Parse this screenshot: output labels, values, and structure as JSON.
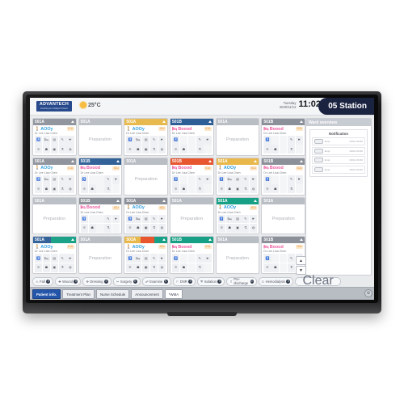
{
  "header": {
    "logo_name": "ADVANTECH",
    "logo_tagline": "Enabling an Intelligent Planet",
    "weather_icon": "sun-icon",
    "temperature": "25°C",
    "day": "Tuesday",
    "date": "2020/11/12",
    "time": "11:02",
    "station": "05 Station"
  },
  "cards": [
    {
      "room": "501A",
      "state": "occupied",
      "header_color": "#8c9099",
      "segments": [],
      "patient": "AOOy",
      "patient_color": "#2f9fe0",
      "patient_icon": "walking-icon",
      "badge": "ICU",
      "doctor": "Dr Lee  Lisa Chen",
      "icons": [
        "wheelchair",
        "bed",
        "clipboard",
        "pen",
        "hand",
        "monitor",
        "person",
        "drip",
        "flask",
        "gauge"
      ],
      "icons_on": [
        1,
        1,
        1,
        1,
        1,
        1,
        1,
        1,
        1,
        1
      ]
    },
    {
      "room": "501A",
      "state": "preparation",
      "header_color": "#b9bdc4",
      "segments": [],
      "prep": "Preparation"
    },
    {
      "room": "501A",
      "state": "occupied",
      "header_color": "#e8b84b",
      "segments": [],
      "patient": "AOOy",
      "patient_color": "#2f9fe0",
      "patient_icon": "walking-icon",
      "badge": "ICU",
      "doctor": "Dr Lee  Lisa Chen",
      "icons": [
        "wheelchair",
        "bed",
        "clipboard",
        "pen",
        "hand",
        "monitor",
        "person",
        "drip",
        "flask",
        "gauge"
      ],
      "icons_on": [
        1,
        1,
        1,
        1,
        1,
        1,
        1,
        1,
        1,
        1
      ]
    },
    {
      "room": "501B",
      "state": "occupied",
      "header_color": "#2e5e96",
      "segments": [],
      "patient": "Boood",
      "patient_color": "#ef5aa0",
      "patient_icon": "bed-icon",
      "badge": "ICU",
      "doctor": "Dr Lee  Lisa Chen",
      "icons": [
        "wheelchair",
        "bed",
        "clipboard",
        "pen",
        "hand",
        "monitor",
        "person",
        "drip",
        "flask",
        "gauge"
      ],
      "icons_on": [
        1,
        0,
        0,
        1,
        1,
        1,
        1,
        0,
        1,
        0
      ]
    },
    {
      "room": "501A",
      "state": "preparation",
      "header_color": "#b9bdc4",
      "segments": [],
      "prep": "Preparation"
    },
    {
      "room": "501B",
      "state": "occupied",
      "header_color": "#8c9099",
      "segments": [],
      "patient": "Boood",
      "patient_color": "#ef5aa0",
      "patient_icon": "bed-icon",
      "badge": "ICU",
      "doctor": "Dr Lee  Lisa Chen",
      "icons": [
        "wheelchair",
        "bed",
        "clipboard",
        "pen",
        "hand",
        "monitor",
        "person",
        "drip",
        "flask",
        "gauge"
      ],
      "icons_on": [
        1,
        0,
        0,
        1,
        1,
        1,
        1,
        0,
        1,
        0
      ]
    },
    {
      "room": "501A",
      "state": "occupied",
      "header_color": "#8c9099",
      "segments": [],
      "patient": "AOOy",
      "patient_color": "#2f9fe0",
      "patient_icon": "walking-icon",
      "badge": "ICU",
      "doctor": "Dr Lee  Lisa Chen",
      "icons": [
        "wheelchair",
        "bed",
        "clipboard",
        "pen",
        "hand",
        "monitor",
        "person",
        "drip",
        "flask",
        "gauge"
      ],
      "icons_on": [
        1,
        1,
        1,
        1,
        1,
        1,
        1,
        1,
        1,
        1
      ]
    },
    {
      "room": "501B",
      "state": "occupied",
      "header_color": "#2e5e96",
      "segments": [],
      "patient": "Boood",
      "patient_color": "#ef5aa0",
      "patient_icon": "bed-icon",
      "badge": "ICU",
      "doctor": "Dr Lee  Lisa Chen",
      "icons": [
        "wheelchair",
        "bed",
        "clipboard",
        "pen",
        "hand",
        "monitor",
        "person",
        "drip",
        "flask",
        "gauge"
      ],
      "icons_on": [
        1,
        0,
        0,
        1,
        1,
        1,
        1,
        0,
        1,
        0
      ]
    },
    {
      "room": "501A",
      "state": "preparation",
      "header_color": "#b9bdc4",
      "segments": [],
      "prep": "Preparation"
    },
    {
      "room": "501B",
      "state": "occupied",
      "header_color": "#e8562f",
      "segments": [],
      "patient": "Boood",
      "patient_color": "#ef5aa0",
      "patient_icon": "bed-icon",
      "badge": "ICU",
      "doctor": "Dr Lee  Lisa Chen",
      "icons": [
        "wheelchair",
        "bed",
        "clipboard",
        "pen",
        "hand",
        "monitor",
        "person",
        "drip",
        "flask",
        "gauge"
      ],
      "icons_on": [
        1,
        0,
        0,
        1,
        1,
        1,
        1,
        0,
        1,
        0
      ]
    },
    {
      "room": "501A",
      "state": "occupied",
      "header_color": "#e8b84b",
      "segments": [],
      "patient": "AOOy",
      "patient_color": "#2f9fe0",
      "patient_icon": "walking-icon",
      "badge": "ICU",
      "doctor": "Dr Lee  Lisa Chen",
      "icons": [
        "wheelchair",
        "bed",
        "clipboard",
        "pen",
        "hand",
        "monitor",
        "person",
        "drip",
        "flask",
        "gauge"
      ],
      "icons_on": [
        1,
        1,
        1,
        1,
        1,
        1,
        1,
        1,
        1,
        1
      ]
    },
    {
      "room": "501B",
      "state": "occupied",
      "header_color": "#8c9099",
      "segments": [],
      "patient": "Boood",
      "patient_color": "#ef5aa0",
      "patient_icon": "bed-icon",
      "badge": "ICU",
      "doctor": "Dr Lee  Lisa Chen",
      "icons": [
        "wheelchair",
        "bed",
        "clipboard",
        "pen",
        "hand",
        "monitor",
        "person",
        "drip",
        "flask",
        "gauge"
      ],
      "icons_on": [
        1,
        0,
        0,
        1,
        1,
        1,
        1,
        0,
        1,
        0
      ]
    },
    {
      "room": "501A",
      "state": "preparation",
      "header_color": "#b9bdc4",
      "segments": [],
      "prep": "Preparation"
    },
    {
      "room": "501B",
      "state": "occupied",
      "header_color": "#8c9099",
      "segments": [],
      "patient": "Boood",
      "patient_color": "#ef5aa0",
      "patient_icon": "bed-icon",
      "badge": "ICU",
      "doctor": "Dr Lee  Lisa Chen",
      "icons": [
        "wheelchair",
        "bed",
        "clipboard",
        "pen",
        "hand",
        "monitor",
        "person",
        "drip",
        "flask",
        "gauge"
      ],
      "icons_on": [
        1,
        0,
        0,
        1,
        1,
        1,
        1,
        0,
        1,
        0
      ]
    },
    {
      "room": "501A",
      "state": "occupied",
      "header_color": "#8c9099",
      "segments": [],
      "patient": "AOOy",
      "patient_color": "#2f9fe0",
      "patient_icon": "walking-icon",
      "badge": "ICU",
      "doctor": "Dr Lee  Lisa Chen",
      "icons": [
        "wheelchair",
        "bed",
        "clipboard",
        "pen",
        "hand",
        "monitor",
        "person",
        "drip",
        "flask",
        "gauge"
      ],
      "icons_on": [
        1,
        1,
        1,
        1,
        1,
        1,
        1,
        1,
        1,
        1
      ]
    },
    {
      "room": "501A",
      "state": "preparation",
      "header_color": "#b9bdc4",
      "segments": [],
      "prep": "Preparation"
    },
    {
      "room": "501A",
      "state": "occupied",
      "header_color": "#17a085",
      "segments": [],
      "patient": "AOOy",
      "patient_color": "#2f9fe0",
      "patient_icon": "walking-icon",
      "badge": "ICU",
      "doctor": "Dr Lee  Lisa Chen",
      "icons": [
        "wheelchair",
        "bed",
        "clipboard",
        "pen",
        "hand",
        "monitor",
        "person",
        "drip",
        "flask",
        "gauge"
      ],
      "icons_on": [
        1,
        1,
        1,
        1,
        1,
        1,
        1,
        1,
        1,
        1
      ]
    },
    {
      "room": "501A",
      "state": "preparation",
      "header_color": "#b9bdc4",
      "segments": [],
      "prep": "Preparation"
    },
    {
      "room": "501A",
      "state": "occupied",
      "header_color": "#2e5e96",
      "segments": [
        {
          "color": "#17a085",
          "left": "42%",
          "width": "58%"
        }
      ],
      "patient": "AOOy",
      "patient_color": "#2f9fe0",
      "patient_icon": "walking-icon",
      "badge": "ICU",
      "doctor": "Dr Lee  Lisa Chen",
      "icons": [
        "wheelchair",
        "bed",
        "clipboard",
        "pen",
        "hand",
        "monitor",
        "person",
        "drip",
        "flask",
        "gauge"
      ],
      "icons_on": [
        1,
        1,
        1,
        1,
        1,
        1,
        1,
        1,
        1,
        1
      ]
    },
    {
      "room": "501A",
      "state": "preparation",
      "header_color": "#b9bdc4",
      "segments": [],
      "prep": "Preparation"
    },
    {
      "room": "501A",
      "state": "occupied",
      "header_color": "#e8b84b",
      "segments": [
        {
          "color": "#e8562f",
          "left": "38%",
          "width": "32%"
        },
        {
          "color": "#17a085",
          "left": "70%",
          "width": "30%"
        }
      ],
      "patient": "AOOy",
      "patient_color": "#2f9fe0",
      "patient_icon": "walking-icon",
      "badge": "ICU",
      "doctor": "Dr Lee  Lisa Chen",
      "icons": [
        "wheelchair",
        "bed",
        "clipboard",
        "pen",
        "hand",
        "monitor",
        "person",
        "drip",
        "flask",
        "gauge"
      ],
      "icons_on": [
        1,
        1,
        1,
        1,
        1,
        1,
        1,
        1,
        1,
        1
      ]
    },
    {
      "room": "501B",
      "state": "occupied",
      "header_color": "#17a085",
      "segments": [],
      "patient": "Boood",
      "patient_color": "#ef5aa0",
      "patient_icon": "bed-icon",
      "badge": "ICU",
      "doctor": "Dr Lee  Lisa Chen",
      "icons": [
        "wheelchair",
        "bed",
        "clipboard",
        "pen",
        "hand",
        "monitor",
        "person",
        "drip",
        "flask",
        "gauge"
      ],
      "icons_on": [
        1,
        0,
        0,
        1,
        1,
        1,
        1,
        0,
        1,
        0
      ]
    },
    {
      "room": "501A",
      "state": "preparation",
      "header_color": "#b9bdc4",
      "segments": [],
      "prep": "Preparation"
    },
    {
      "room": "501B",
      "state": "occupied",
      "header_color": "#8c9099",
      "segments": [],
      "patient": "Boood",
      "patient_color": "#ef5aa0",
      "patient_icon": "bed-icon",
      "badge": "ICU",
      "doctor": "Dr Lee  Lisa Chen",
      "icons": [
        "wheelchair",
        "bed",
        "clipboard",
        "pen",
        "hand",
        "monitor",
        "person",
        "drip",
        "flask",
        "gauge"
      ],
      "icons_on": [
        1,
        0,
        0,
        1,
        1,
        1,
        1,
        0,
        1,
        0
      ]
    }
  ],
  "ward_overview": {
    "title": "Ward overview",
    "notification_title": "Notification",
    "rows": [
      {
        "label": "Emp",
        "date": "04/12 20:30"
      },
      {
        "label": "Emp",
        "date": "04/12 20:30"
      },
      {
        "label": "Emp",
        "date": "04/12 20:30"
      },
      {
        "label": "Emp",
        "date": "04/12 20:30"
      }
    ]
  },
  "scroller": {
    "up": "▲",
    "down": "▼"
  },
  "chips": [
    {
      "icon": "fall-icon",
      "label": "Fall",
      "count": "0"
    },
    {
      "icon": "wound-icon",
      "label": "Wound",
      "count": "0"
    },
    {
      "icon": "dressing-icon",
      "label": "Dressing",
      "count": "0"
    },
    {
      "icon": "surgery-icon",
      "label": "Surgery",
      "count": "0"
    },
    {
      "icon": "examine-icon",
      "label": "Examine",
      "count": "0"
    },
    {
      "icon": "dnr-icon",
      "label": "DNR",
      "count": "0"
    },
    {
      "icon": "isolation-icon",
      "label": "Isolation",
      "count": "0"
    },
    {
      "icon": "predischarge-icon",
      "label": "Pre-discharge",
      "count": "0"
    },
    {
      "icon": "hemodialysis-icon",
      "label": "Hemodialysis",
      "count": "0"
    }
  ],
  "clear_label": "Clear",
  "tabs": [
    {
      "label": "Patient info.",
      "active": true
    },
    {
      "label": "Treatment Plan",
      "active": false
    },
    {
      "label": "Nurse Schedule",
      "active": false
    },
    {
      "label": "Announcement",
      "active": false
    },
    {
      "label": "*WMA",
      "active": false,
      "style": "wma"
    }
  ],
  "gear_icon": "gear-icon"
}
